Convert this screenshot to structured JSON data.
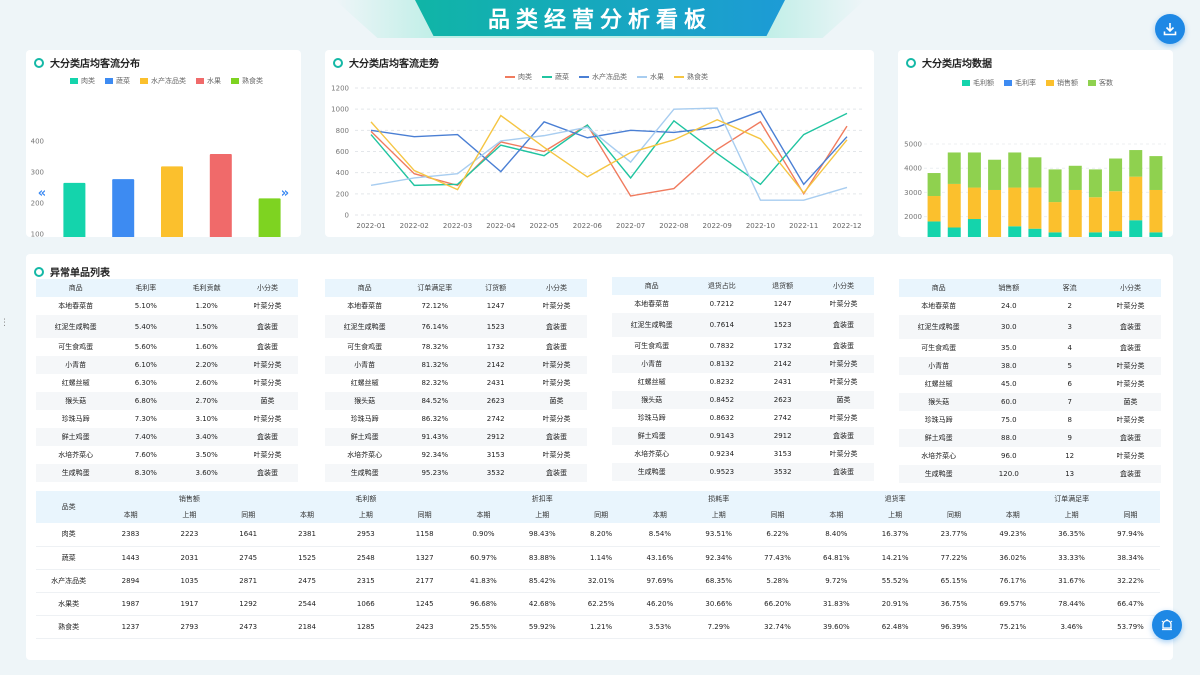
{
  "header": {
    "title": "品类经营分析看板"
  },
  "colors": {
    "meat": "#14d4ac",
    "veg": "#3d8bf2",
    "aqua": "#fbc02d",
    "fruit": "#f06a6a",
    "deli": "#7ed321",
    "teal": "#14b8a6",
    "lightblue": "#a8cdf0"
  },
  "panels": {
    "bar": {
      "title": "大分类店均客流分布"
    },
    "line": {
      "title": "大分类店均客流走势"
    },
    "stack": {
      "title": "大分类店均数据"
    },
    "anomaly": {
      "title": "异常单品列表"
    }
  },
  "icons": {
    "download": "download-icon",
    "float": "bell-icon",
    "prev": "chevron-left-icon",
    "next": "chevron-right-icon"
  },
  "chart_data": [
    {
      "type": "bar",
      "title": "大分类店均客流分布",
      "categories": [
        "肉类",
        "蔬菜",
        "水产冻品类",
        "水果",
        "熟食类"
      ],
      "values": [
        265,
        277,
        318,
        358,
        215
      ],
      "legend": [
        "肉类",
        "蔬菜",
        "水产冻品类",
        "水果",
        "熟食类"
      ],
      "yticks": [
        "0",
        "100",
        "200",
        "300",
        "400"
      ],
      "ylim": [
        0,
        400
      ]
    },
    {
      "type": "line",
      "title": "大分类店均客流走势",
      "x": [
        "2022-01",
        "2022-02",
        "2022-03",
        "2022-04",
        "2022-05",
        "2022-06",
        "2022-07",
        "2022-08",
        "2022-09",
        "2022-10",
        "2022-11",
        "2022-12"
      ],
      "yticks": [
        "0",
        "200",
        "400",
        "600",
        "800",
        "1000",
        "1200"
      ],
      "ylim": [
        0,
        1200
      ],
      "series": [
        {
          "name": "肉类",
          "values": [
            790,
            390,
            280,
            690,
            600,
            850,
            180,
            250,
            620,
            880,
            200,
            840
          ]
        },
        {
          "name": "蔬菜",
          "values": [
            760,
            280,
            290,
            660,
            560,
            850,
            350,
            890,
            580,
            290,
            760,
            960
          ]
        },
        {
          "name": "水产冻品类",
          "values": [
            800,
            740,
            760,
            410,
            880,
            730,
            800,
            780,
            830,
            980,
            290,
            740
          ]
        },
        {
          "name": "水果",
          "values": [
            280,
            350,
            390,
            700,
            750,
            830,
            500,
            1000,
            1010,
            140,
            140,
            260
          ]
        },
        {
          "name": "熟食类",
          "values": [
            880,
            420,
            240,
            940,
            640,
            360,
            590,
            710,
            900,
            720,
            210,
            710
          ]
        }
      ]
    },
    {
      "type": "bar",
      "stacked": true,
      "title": "大分类店均数据",
      "x": [
        "2022-01",
        "2022-02",
        "2022-03",
        "2022-04",
        "2022-05",
        "2022-06",
        "2022-07",
        "2022-08",
        "2022-09",
        "2022-10",
        "2022-11",
        "2022-12"
      ],
      "xticks": [
        "2022-01",
        "2022-03",
        "2022-05",
        "2022-07",
        "2022-09",
        "2022-11"
      ],
      "yticks": [
        "0",
        "1000",
        "2000",
        "3000",
        "4000",
        "5000"
      ],
      "ylim": [
        0,
        5000
      ],
      "series": [
        {
          "name": "毛利额",
          "values": [
            1800,
            1550,
            1900,
            1050,
            1600,
            1500,
            1350,
            1150,
            1350,
            1400,
            1850,
            1350
          ]
        },
        {
          "name": "毛利率",
          "values": [
            0,
            0,
            0,
            0,
            0,
            0,
            0,
            0,
            0,
            0,
            0,
            0
          ]
        },
        {
          "name": "销售额",
          "values": [
            1050,
            1800,
            1300,
            2050,
            1600,
            1700,
            1250,
            1950,
            1450,
            1650,
            1800,
            1750
          ]
        },
        {
          "name": "客数",
          "values": [
            950,
            1300,
            1450,
            1250,
            1450,
            1250,
            1350,
            1000,
            1150,
            1350,
            1100,
            1400
          ]
        }
      ]
    }
  ],
  "anomaly_tables": [
    {
      "headers": [
        "商品",
        "毛利率",
        "毛利贡献",
        "小分类"
      ],
      "rows": [
        [
          "本地春菜苗",
          "5.10%",
          "1.20%",
          "叶菜分类"
        ],
        [
          "红泥生咸鸭蛋",
          "5.40%",
          "1.50%",
          "盒装蛋"
        ],
        [
          "可生食鸡蛋",
          "5.60%",
          "1.60%",
          "盒装蛋"
        ],
        [
          "小青苗",
          "6.10%",
          "2.20%",
          "叶菜分类"
        ],
        [
          "红螺丝椒",
          "6.30%",
          "2.60%",
          "叶菜分类"
        ],
        [
          "猴头菇",
          "6.80%",
          "2.70%",
          "菌类"
        ],
        [
          "珍珠马蹄",
          "7.30%",
          "3.10%",
          "叶菜分类"
        ],
        [
          "鲜土鸡蛋",
          "7.40%",
          "3.40%",
          "盒装蛋"
        ],
        [
          "水培芥菜心",
          "7.60%",
          "3.50%",
          "叶菜分类"
        ],
        [
          "生咸鸭蛋",
          "8.30%",
          "3.60%",
          "盒装蛋"
        ]
      ]
    },
    {
      "headers": [
        "商品",
        "订单满足率",
        "订货额",
        "小分类"
      ],
      "rows": [
        [
          "本地春菜苗",
          "72.12%",
          "1247",
          "叶菜分类"
        ],
        [
          "红泥生咸鸭蛋",
          "76.14%",
          "1523",
          "盒装蛋"
        ],
        [
          "可生食鸡蛋",
          "78.32%",
          "1732",
          "盒装蛋"
        ],
        [
          "小青苗",
          "81.32%",
          "2142",
          "叶菜分类"
        ],
        [
          "红螺丝椒",
          "82.32%",
          "2431",
          "叶菜分类"
        ],
        [
          "猴头菇",
          "84.52%",
          "2623",
          "菌类"
        ],
        [
          "珍珠马蹄",
          "86.32%",
          "2742",
          "叶菜分类"
        ],
        [
          "鲜土鸡蛋",
          "91.43%",
          "2912",
          "盒装蛋"
        ],
        [
          "水培芥菜心",
          "92.34%",
          "3153",
          "叶菜分类"
        ],
        [
          "生咸鸭蛋",
          "95.23%",
          "3532",
          "盒装蛋"
        ]
      ]
    },
    {
      "headers": [
        "商品",
        "退货占比",
        "退货额",
        "小分类"
      ],
      "rows": [
        [
          "本地春菜苗",
          "0.7212",
          "1247",
          "叶菜分类"
        ],
        [
          "红泥生咸鸭蛋",
          "0.7614",
          "1523",
          "盒装蛋"
        ],
        [
          "可生食鸡蛋",
          "0.7832",
          "1732",
          "盒装蛋"
        ],
        [
          "小青苗",
          "0.8132",
          "2142",
          "叶菜分类"
        ],
        [
          "红螺丝椒",
          "0.8232",
          "2431",
          "叶菜分类"
        ],
        [
          "猴头菇",
          "0.8452",
          "2623",
          "菌类"
        ],
        [
          "珍珠马蹄",
          "0.8632",
          "2742",
          "叶菜分类"
        ],
        [
          "鲜土鸡蛋",
          "0.9143",
          "2912",
          "盒装蛋"
        ],
        [
          "水培芥菜心",
          "0.9234",
          "3153",
          "叶菜分类"
        ],
        [
          "生咸鸭蛋",
          "0.9523",
          "3532",
          "盒装蛋"
        ]
      ]
    },
    {
      "headers": [
        "商品",
        "销售额",
        "客流",
        "小分类"
      ],
      "rows": [
        [
          "本地春菜苗",
          "24.0",
          "2",
          "叶菜分类"
        ],
        [
          "红泥生咸鸭蛋",
          "30.0",
          "3",
          "盒装蛋"
        ],
        [
          "可生食鸡蛋",
          "35.0",
          "4",
          "盒装蛋"
        ],
        [
          "小青苗",
          "38.0",
          "5",
          "叶菜分类"
        ],
        [
          "红螺丝椒",
          "45.0",
          "6",
          "叶菜分类"
        ],
        [
          "猴头菇",
          "60.0",
          "7",
          "菌类"
        ],
        [
          "珍珠马蹄",
          "75.0",
          "8",
          "叶菜分类"
        ],
        [
          "鲜土鸡蛋",
          "88.0",
          "9",
          "盒装蛋"
        ],
        [
          "水培芥菜心",
          "96.0",
          "12",
          "叶菜分类"
        ],
        [
          "生咸鸭蛋",
          "120.0",
          "13",
          "盒装蛋"
        ]
      ]
    }
  ],
  "summary_table": {
    "first_header": "品类",
    "groups": [
      "销售额",
      "毛利额",
      "折扣率",
      "损耗率",
      "退货率",
      "订单满足率"
    ],
    "subheaders": [
      "本期",
      "上期",
      "同期"
    ],
    "rows": [
      [
        "肉类",
        "2383",
        "2223",
        "1641",
        "2381",
        "2953",
        "1158",
        "0.90%",
        "98.43%",
        "8.20%",
        "8.54%",
        "93.51%",
        "6.22%",
        "8.40%",
        "16.37%",
        "23.77%",
        "49.23%",
        "36.35%",
        "97.94%"
      ],
      [
        "蔬菜",
        "1443",
        "2031",
        "2745",
        "1525",
        "2548",
        "1327",
        "60.97%",
        "83.88%",
        "1.14%",
        "43.16%",
        "92.34%",
        "77.43%",
        "64.81%",
        "14.21%",
        "77.22%",
        "36.02%",
        "33.33%",
        "38.34%"
      ],
      [
        "水产冻品类",
        "2894",
        "1035",
        "2871",
        "2475",
        "2315",
        "2177",
        "41.83%",
        "85.42%",
        "32.01%",
        "97.69%",
        "68.35%",
        "5.28%",
        "9.72%",
        "55.52%",
        "65.15%",
        "76.17%",
        "31.67%",
        "32.22%"
      ],
      [
        "水果类",
        "1987",
        "1917",
        "1292",
        "2544",
        "1066",
        "1245",
        "96.68%",
        "42.68%",
        "62.25%",
        "46.20%",
        "30.66%",
        "66.20%",
        "31.83%",
        "20.91%",
        "36.75%",
        "69.57%",
        "78.44%",
        "66.47%"
      ],
      [
        "熟食类",
        "1237",
        "2793",
        "2473",
        "2184",
        "1285",
        "2423",
        "25.55%",
        "59.92%",
        "1.21%",
        "3.53%",
        "7.29%",
        "32.74%",
        "39.60%",
        "62.48%",
        "96.39%",
        "75.21%",
        "3.46%",
        "53.79%"
      ]
    ]
  }
}
